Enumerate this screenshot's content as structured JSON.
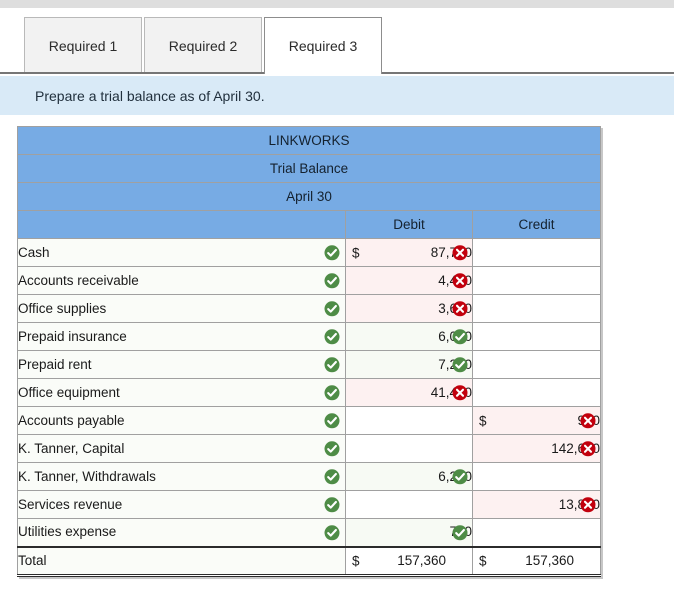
{
  "tabs": [
    {
      "label": "Required 1",
      "active": false
    },
    {
      "label": "Required 2",
      "active": false
    },
    {
      "label": "Required 3",
      "active": true
    }
  ],
  "instruction": "Prepare a trial balance as of April 30.",
  "table": {
    "title_lines": [
      "LINKWORKS",
      "Trial Balance",
      "April 30"
    ],
    "columns": [
      "",
      "Debit",
      "Credit"
    ],
    "rows": [
      {
        "account": "Cash",
        "account_mark": "check",
        "debit": "87,700",
        "debit_dollar": "$",
        "debit_mark": "cross",
        "credit": "",
        "credit_dollar": "",
        "credit_mark": ""
      },
      {
        "account": "Accounts receivable",
        "account_mark": "check",
        "debit": "4,480",
        "debit_dollar": "",
        "debit_mark": "cross",
        "credit": "",
        "credit_dollar": "",
        "credit_mark": ""
      },
      {
        "account": "Office supplies",
        "account_mark": "check",
        "debit": "3,680",
        "debit_dollar": "",
        "debit_mark": "cross",
        "credit": "",
        "credit_dollar": "",
        "credit_mark": ""
      },
      {
        "account": "Prepaid insurance",
        "account_mark": "check",
        "debit": "6,000",
        "debit_dollar": "",
        "debit_mark": "check",
        "credit": "",
        "credit_dollar": "",
        "credit_mark": ""
      },
      {
        "account": "Prepaid rent",
        "account_mark": "check",
        "debit": "7,200",
        "debit_dollar": "",
        "debit_mark": "check",
        "credit": "",
        "credit_dollar": "",
        "credit_mark": ""
      },
      {
        "account": "Office equipment",
        "account_mark": "check",
        "debit": "41,400",
        "debit_dollar": "",
        "debit_mark": "cross",
        "credit": "",
        "credit_dollar": "",
        "credit_mark": ""
      },
      {
        "account": "Accounts payable",
        "account_mark": "check",
        "debit": "",
        "debit_dollar": "",
        "debit_mark": "",
        "credit": "920",
        "credit_dollar": "$",
        "credit_mark": "cross"
      },
      {
        "account": "K. Tanner, Capital",
        "account_mark": "check",
        "debit": "",
        "debit_dollar": "",
        "debit_mark": "",
        "credit": "142,600",
        "credit_dollar": "",
        "credit_mark": "cross"
      },
      {
        "account": "K. Tanner, Withdrawals",
        "account_mark": "check",
        "debit": "6,200",
        "debit_dollar": "",
        "debit_mark": "check",
        "credit": "",
        "credit_dollar": "",
        "credit_mark": ""
      },
      {
        "account": "Services revenue",
        "account_mark": "check",
        "debit": "",
        "debit_dollar": "",
        "debit_mark": "",
        "credit": "13,840",
        "credit_dollar": "",
        "credit_mark": "cross"
      },
      {
        "account": "Utilities expense",
        "account_mark": "check",
        "debit": "700",
        "debit_dollar": "",
        "debit_mark": "check",
        "credit": "",
        "credit_dollar": "",
        "credit_mark": ""
      }
    ],
    "total": {
      "account": "Total",
      "debit": "157,360",
      "debit_dollar": "$",
      "credit": "157,360",
      "credit_dollar": "$"
    }
  },
  "icons": {
    "check": "check-circle-icon",
    "cross": "cross-circle-icon"
  },
  "colors": {
    "header_blue": "#77abe4",
    "banner_blue": "#d9eaf7",
    "check_green": "#4e8c46",
    "cross_red": "#c2000d",
    "error_cell": "#fdf1f1",
    "ok_cell": "#f7faf4"
  }
}
